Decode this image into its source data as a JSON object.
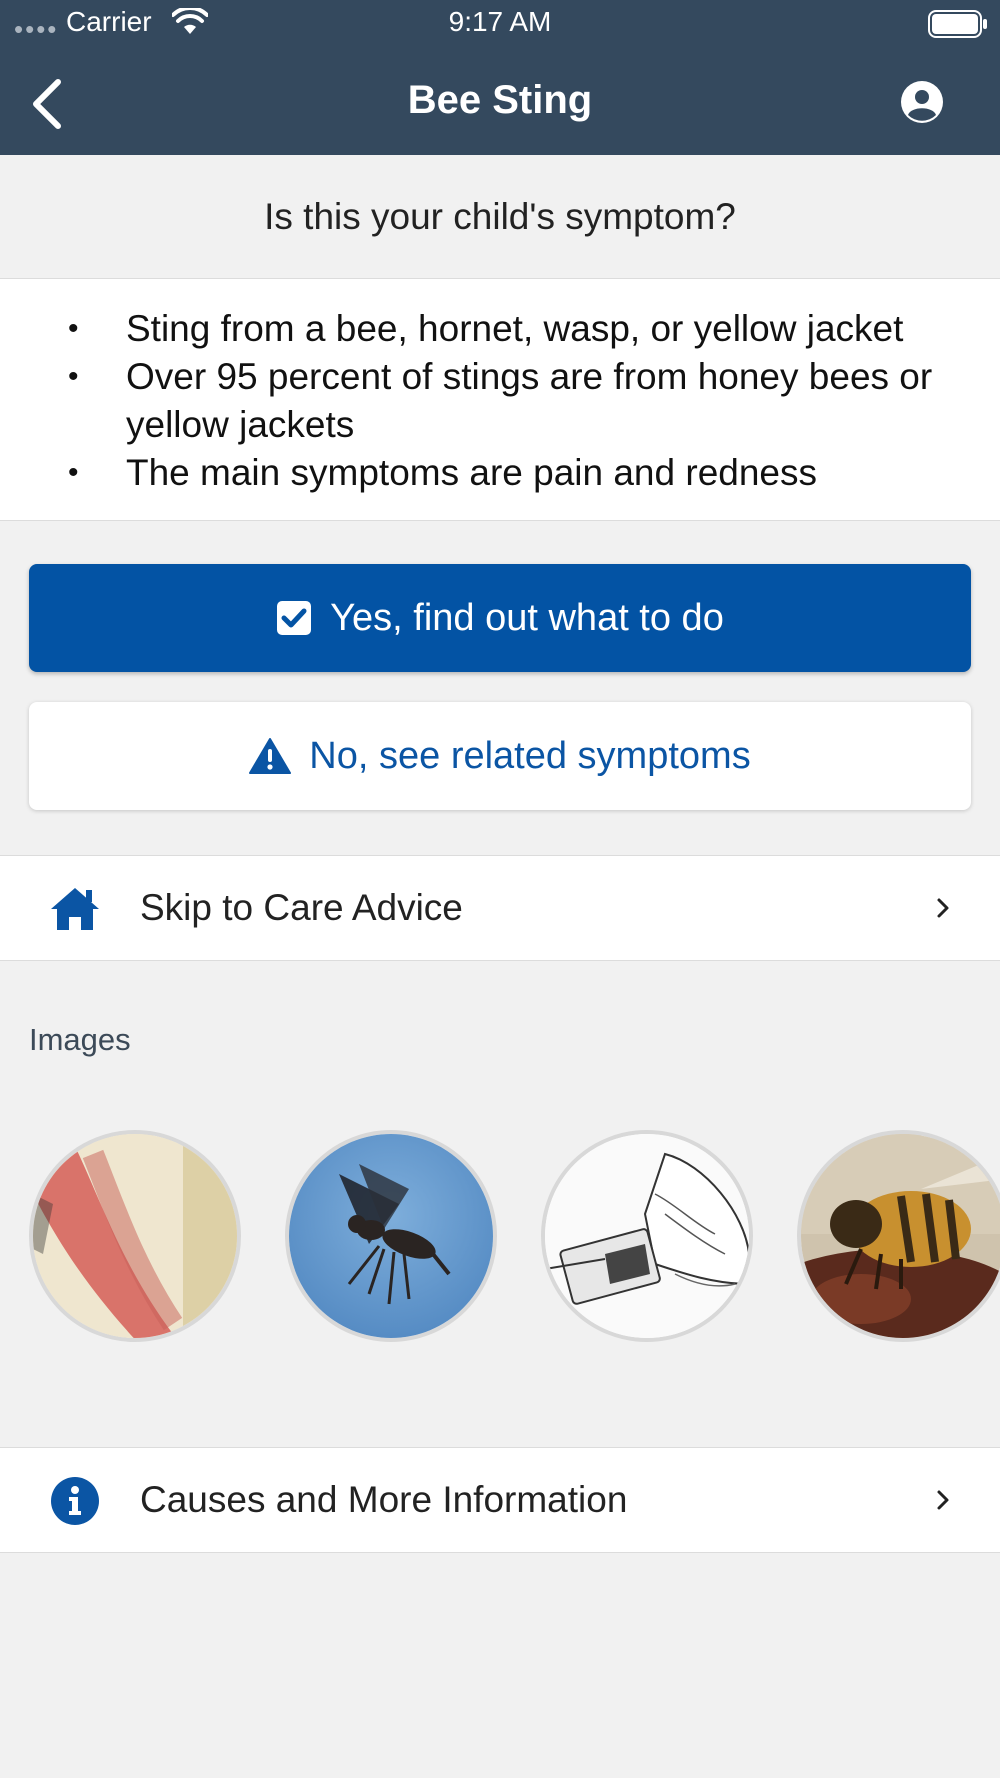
{
  "status": {
    "carrier": "Carrier",
    "time": "9:17 AM"
  },
  "header": {
    "title": "Bee Sting"
  },
  "question": "Is this your child's symptom?",
  "description": [
    "Sting from a bee, hornet, wasp, or yellow jacket",
    "Over 95 percent of stings are from honey bees or yellow jackets",
    "The main symptoms are pain and redness"
  ],
  "actions": {
    "yes_label": "Yes, find out what to do",
    "no_label": "No, see related symptoms"
  },
  "skip_row": {
    "label": "Skip to Care Advice",
    "icon": "home-icon"
  },
  "images_section": {
    "title": "Images"
  },
  "info_row": {
    "label": "Causes and More Information",
    "icon": "info-icon"
  },
  "colors": {
    "header_bg": "#34495e",
    "primary": "#0353a4",
    "page_bg": "#f1f1f1"
  }
}
